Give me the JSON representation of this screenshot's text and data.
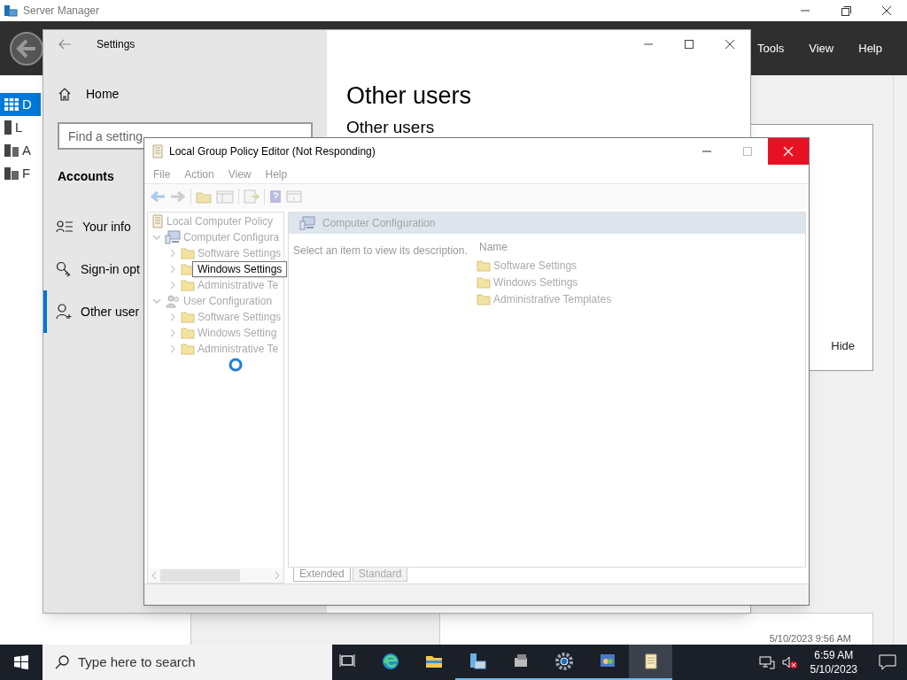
{
  "server_manager": {
    "title": "Server Manager",
    "menu": [
      "Tools",
      "View",
      "Help"
    ],
    "nav": [
      {
        "label": "D",
        "kind": "dashboard",
        "selected": true
      },
      {
        "label": "L",
        "kind": "server",
        "selected": false
      },
      {
        "label": "A",
        "kind": "servers",
        "selected": false
      },
      {
        "label": "F",
        "kind": "files",
        "selected": false
      }
    ],
    "panel_button": "Hide",
    "timestamp": "5/10/2023 9:56 AM"
  },
  "settings": {
    "title": "Settings",
    "home": "Home",
    "search": {
      "placeholder": "Find a setting"
    },
    "section": "Accounts",
    "nav": [
      {
        "label": "Your info",
        "kind": "person-list",
        "selected": false
      },
      {
        "label": "Sign-in opt",
        "kind": "key",
        "selected": false
      },
      {
        "label": "Other user",
        "kind": "person-add",
        "selected": true
      }
    ],
    "heading": "Other users",
    "subheading": "Other users"
  },
  "policy_editor": {
    "title": "Local Group Policy Editor (Not Responding)",
    "menu": [
      "File",
      "Action",
      "View",
      "Help"
    ],
    "tree": [
      {
        "label": "Local Computer Policy",
        "kind": "policy",
        "children": [
          {
            "label": "Computer Configura",
            "kind": "computer",
            "expanded": true,
            "children": [
              {
                "label": "Software Settings",
                "kind": "folder",
                "expanded": false,
                "tooltip": false
              },
              {
                "label": "Windows Settings",
                "kind": "folder",
                "expanded": false,
                "tooltip": true
              },
              {
                "label": "Administrative Te",
                "kind": "folder",
                "expanded": false,
                "tooltip": false
              }
            ]
          },
          {
            "label": "User Configuration",
            "kind": "users",
            "expanded": true,
            "children": [
              {
                "label": "Software Settings",
                "kind": "folder",
                "expanded": false,
                "tooltip": false
              },
              {
                "label": "Windows Setting",
                "kind": "folder",
                "expanded": false,
                "tooltip": false
              },
              {
                "label": "Administrative Te",
                "kind": "folder",
                "expanded": false,
                "tooltip": false
              }
            ]
          }
        ]
      }
    ],
    "header": "Computer Configuration",
    "description": "Select an item to view its description.",
    "column": "Name",
    "items": [
      "Software Settings",
      "Windows Settings",
      "Administrative Templates"
    ],
    "tabs": [
      {
        "label": "Extended",
        "selected": true
      },
      {
        "label": "Standard",
        "selected": false
      }
    ]
  },
  "taskbar": {
    "search": {
      "placeholder": "Type here to search"
    },
    "apps": [
      {
        "kind": "task-view",
        "running": false,
        "selected": false
      },
      {
        "kind": "browser",
        "running": false,
        "selected": false
      },
      {
        "kind": "folder",
        "running": false,
        "selected": false
      },
      {
        "kind": "server",
        "running": true,
        "selected": false
      },
      {
        "kind": "computer",
        "running": true,
        "selected": false
      },
      {
        "kind": "gear",
        "running": true,
        "selected": false
      },
      {
        "kind": "users",
        "running": true,
        "selected": false
      },
      {
        "kind": "scroll",
        "running": true,
        "selected": true
      }
    ],
    "time": "6:59 AM",
    "date": "5/10/2023"
  }
}
